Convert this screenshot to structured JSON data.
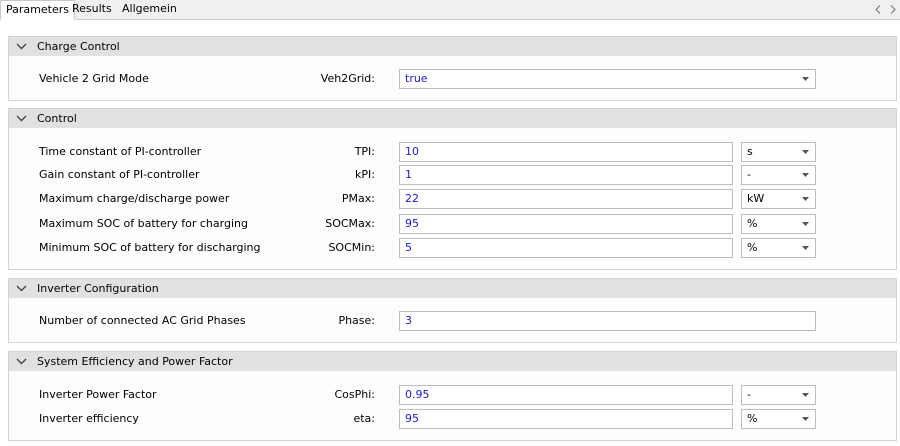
{
  "tabs": [
    {
      "label": "Parameters",
      "active": true
    },
    {
      "label": "Results",
      "active": false
    },
    {
      "label": "Allgemein",
      "active": false
    }
  ],
  "groups": {
    "charge_control": {
      "title": "Charge Control",
      "rows": [
        {
          "label": "Vehicle 2 Grid Mode",
          "name": "Veh2Grid:",
          "value": "true"
        }
      ]
    },
    "control": {
      "title": "Control",
      "rows": [
        {
          "label": "Time constant of PI-controller",
          "name": "TPI:",
          "value": "10",
          "unit": "s"
        },
        {
          "label": "Gain constant of PI-controller",
          "name": "kPI:",
          "value": "1",
          "unit": "-"
        },
        {
          "label": "Maximum charge/discharge power",
          "name": "PMax:",
          "value": "22",
          "unit": "kW"
        },
        {
          "label": "Maximum SOC of battery for charging",
          "name": "SOCMax:",
          "value": "95",
          "unit": "%"
        },
        {
          "label": "Minimum SOC of battery for discharging",
          "name": "SOCMin:",
          "value": "5",
          "unit": "%"
        }
      ]
    },
    "inverter": {
      "title": "Inverter Configuration",
      "rows": [
        {
          "label": "Number of connected AC Grid Phases",
          "name": "Phase:",
          "value": "3"
        }
      ]
    },
    "efficiency": {
      "title": "System Efficiency and Power Factor",
      "rows": [
        {
          "label": "Inverter Power Factor",
          "name": "CosPhi:",
          "value": "0.95",
          "unit": "-"
        },
        {
          "label": "Inverter efficiency",
          "name": "eta:",
          "value": "95",
          "unit": "%"
        }
      ]
    }
  },
  "colors": {
    "value_text": "#1a1acc",
    "group_header": "#e1e1e1"
  }
}
